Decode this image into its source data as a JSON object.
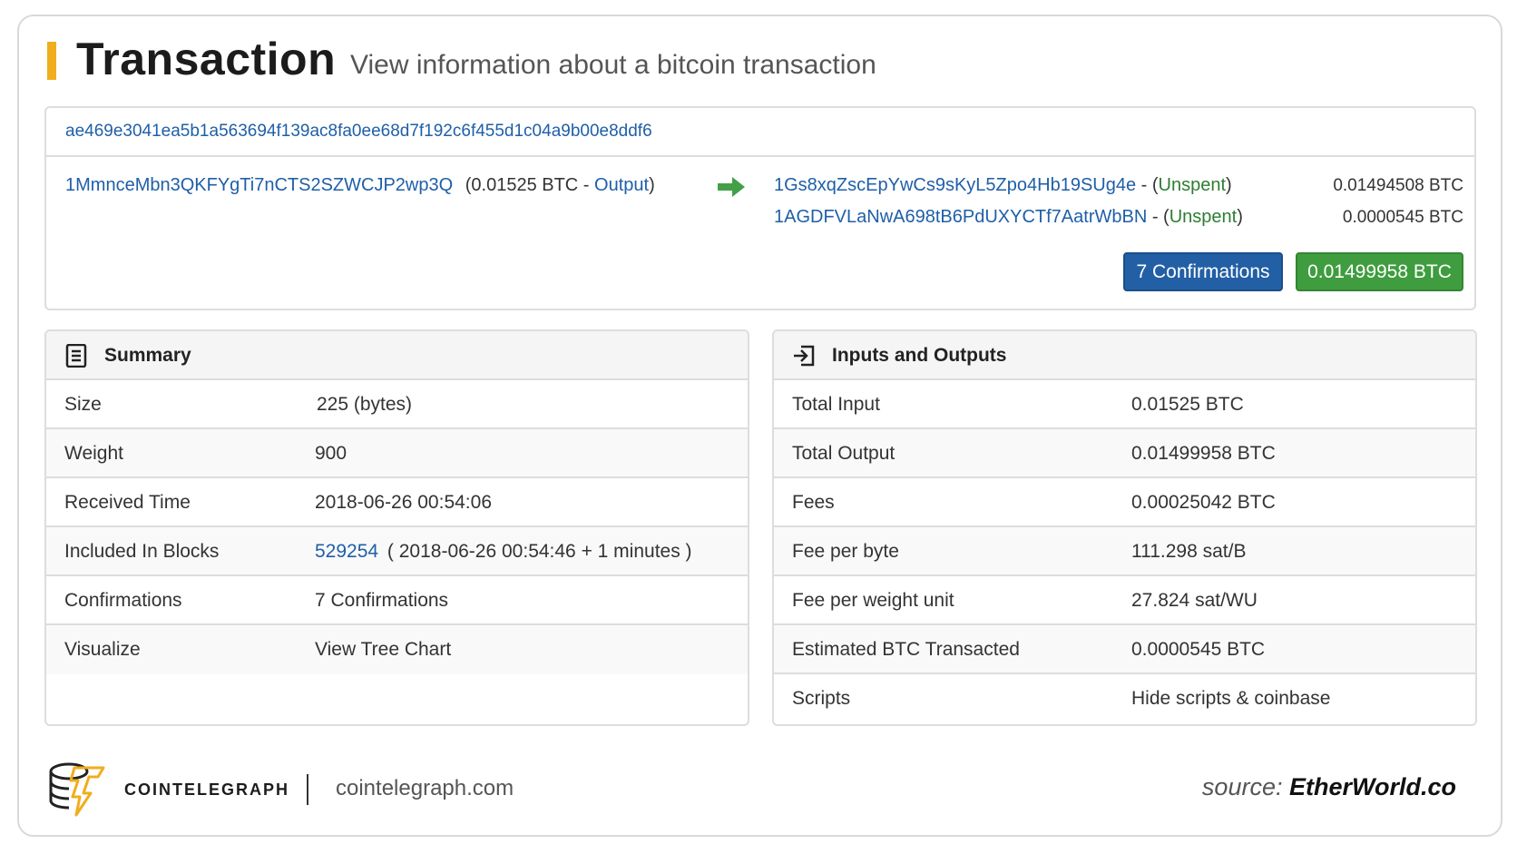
{
  "header": {
    "title": "Transaction",
    "subtitle": "View information about a bitcoin transaction"
  },
  "transaction": {
    "hash": "ae469e3041ea5b1a563694f139ac8fa0ee68d7f192c6f455d1c04a9b00e8ddf6",
    "input": {
      "address": "1MmnceMbn3QKFYgTi7nCTS2SZWCJP2wp3Q",
      "amount_prefix": "(0.01525 BTC - ",
      "status": "Output",
      "suffix": ")"
    },
    "outputs": [
      {
        "address": "1Gs8xqZscEpYwCs9sKyL5Zpo4Hb19SUg4e",
        "sep": " - (",
        "status": "Unspent",
        "close": ")",
        "amount": "0.01494508 BTC"
      },
      {
        "address": "1AGDFVLaNwA698tB6PdUXYCTf7AatrWbBN",
        "sep": " - (",
        "status": "Unspent",
        "close": ")",
        "amount": "0.0000545 BTC"
      }
    ],
    "confirmations_button": "7 Confirmations",
    "total_button": "0.01499958 BTC"
  },
  "summary": {
    "title": "Summary",
    "rows": [
      {
        "label": "Size",
        "value": "225 (bytes)"
      },
      {
        "label": "Weight",
        "value": "900"
      },
      {
        "label": "Received Time",
        "value": "2018-06-26 00:54:06"
      },
      {
        "label": "Included In Blocks",
        "block": "529254",
        "value": " ( 2018-06-26 00:54:46 + 1 minutes )"
      },
      {
        "label": "Confirmations",
        "value": "7 Confirmations"
      },
      {
        "label": "Visualize",
        "link": "View Tree Chart"
      }
    ]
  },
  "io": {
    "title": "Inputs and Outputs",
    "rows": [
      {
        "label": "Total Input",
        "value": "0.01525 BTC"
      },
      {
        "label": "Total Output",
        "value": "0.01499958 BTC"
      },
      {
        "label": "Fees",
        "value": "0.00025042 BTC"
      },
      {
        "label": "Fee per byte",
        "value": "111.298 sat/B"
      },
      {
        "label": "Fee per weight unit",
        "value": "27.824 sat/WU"
      },
      {
        "label": "Estimated BTC Transacted",
        "value": "0.0000545 BTC"
      },
      {
        "label": "Scripts",
        "link": "Hide scripts & coinbase"
      }
    ]
  },
  "footer": {
    "brand": "COINTELEGRAPH",
    "domain": "cointelegraph.com",
    "source_label": "source: ",
    "source_name": "EtherWorld.co"
  },
  "colors": {
    "accent": "#f0ad1e",
    "link": "#1f5fa8",
    "confirm_button": "#225fa5",
    "amount_button": "#3f9d3f",
    "unspent": "#2e7d32"
  },
  "icons": {
    "arrow": "right-arrow-icon",
    "summary": "document-list-icon",
    "io": "sign-in-icon",
    "logo": "cointelegraph-logo-icon"
  }
}
